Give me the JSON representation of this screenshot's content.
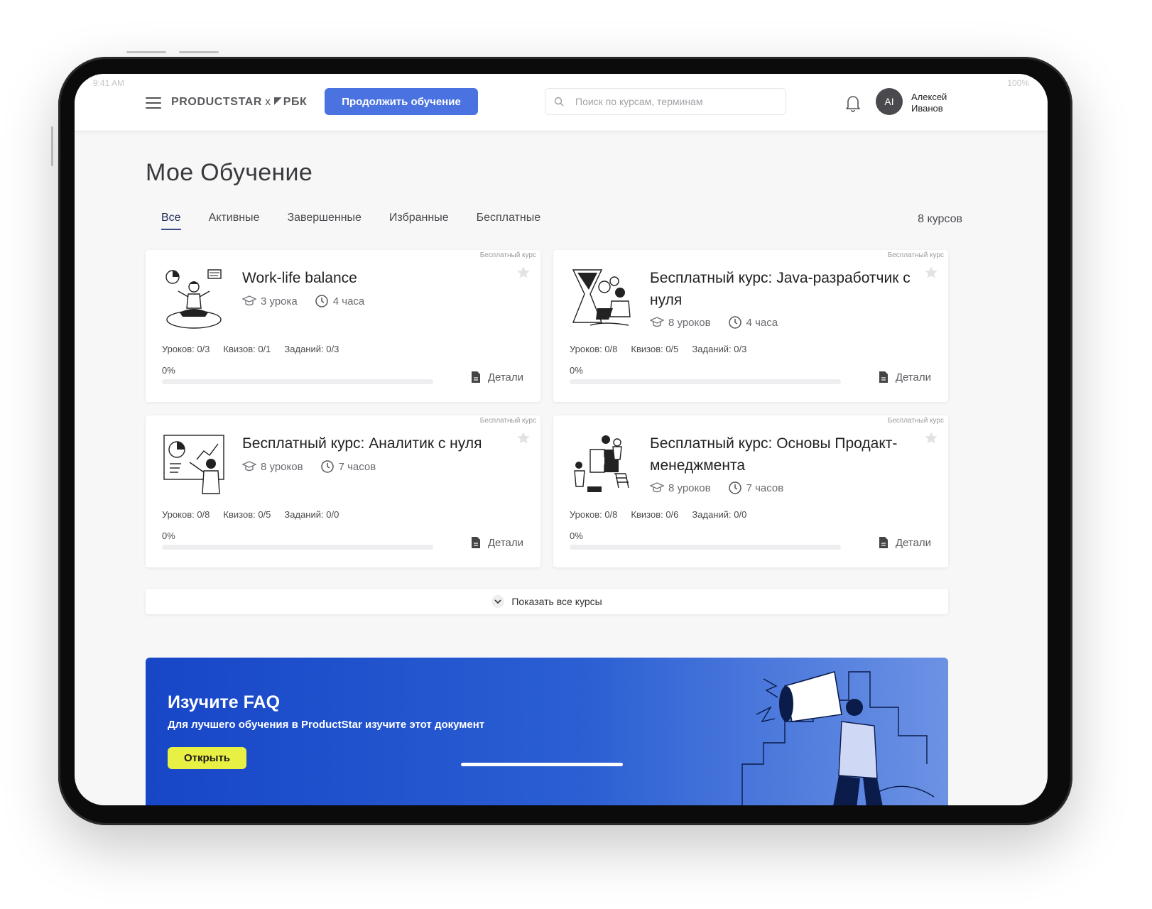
{
  "status": {
    "time": "9:41 AM",
    "battery": "100%"
  },
  "header": {
    "brand": "PRODUCTSTAR",
    "brand_x": "x",
    "brand_partner": "РБК",
    "continue_label": "Продолжить обучение",
    "search_placeholder": "Поиск по курсам, терминам",
    "avatar_initials": "AI",
    "user_name": "Алексей Иванов"
  },
  "page": {
    "title": "Мое Обучение",
    "tabs": [
      "Все",
      "Активные",
      "Завершенные",
      "Избранные",
      "Бесплатные"
    ],
    "active_tab": "Все",
    "count": "8 курсов"
  },
  "courses": [
    {
      "badge": "Бесплатный курс",
      "title": "Work-life balance",
      "lessons": "3 урока",
      "duration": "4 часа",
      "stats_lessons": "Уроков: 0/3",
      "stats_quiz": "Квизов: 0/1",
      "stats_tasks": "Заданий: 0/3",
      "progress_label": "0%",
      "progress": 0,
      "details": "Детали",
      "illustration": "meditation-illustration"
    },
    {
      "badge": "Бесплатный курс",
      "title": "Бесплатный курс: Java-разработчик с нуля",
      "lessons": "8 уроков",
      "duration": "4 часа",
      "stats_lessons": "Уроков: 0/8",
      "stats_quiz": "Квизов: 0/5",
      "stats_tasks": "Заданий: 0/3",
      "progress_label": "0%",
      "progress": 0,
      "details": "Детали",
      "illustration": "developer-illustration"
    },
    {
      "badge": "Бесплатный курс",
      "title": "Бесплатный курс: Аналитик с нуля",
      "lessons": "8 уроков",
      "duration": "7 часов",
      "stats_lessons": "Уроков: 0/8",
      "stats_quiz": "Квизов: 0/5",
      "stats_tasks": "Заданий: 0/0",
      "progress_label": "0%",
      "progress": 0,
      "details": "Детали",
      "illustration": "analytics-illustration"
    },
    {
      "badge": "Бесплатный курс",
      "title": "Бесплатный курс: Основы Продакт-менеджмента",
      "lessons": "8 уроков",
      "duration": "7 часов",
      "stats_lessons": "Уроков: 0/8",
      "stats_quiz": "Квизов: 0/6",
      "stats_tasks": "Заданий: 0/0",
      "progress_label": "0%",
      "progress": 0,
      "details": "Детали",
      "illustration": "puzzle-team-illustration"
    }
  ],
  "show_all": "Показать все курсы",
  "faq": {
    "title": "Изучите FAQ",
    "subtitle": "Для лучшего обучения в ProductStar изучите этот документ",
    "button": "Открыть"
  },
  "colors": {
    "accent": "#4a72e0",
    "banner": "#1746c7",
    "faq_button": "#e8f044"
  }
}
